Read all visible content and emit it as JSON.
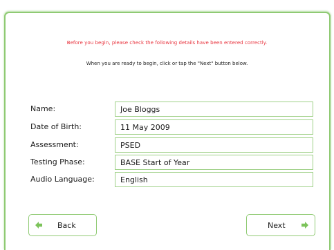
{
  "colors": {
    "accent_green": "#8fca73",
    "warning_red": "#e8323c"
  },
  "notice": {
    "warning": "Before you begin, please check the following details have been entered correctly.",
    "instruction": "When you are ready to begin, click or tap the \"Next\" button below."
  },
  "details": {
    "name": {
      "label": "Name:",
      "value": "Joe Bloggs"
    },
    "dob": {
      "label": "Date of Birth:",
      "value": "11 May 2009"
    },
    "assessment": {
      "label": "Assessment:",
      "value": "PSED"
    },
    "phase": {
      "label": "Testing Phase:",
      "value": "BASE Start of Year"
    },
    "language": {
      "label": "Audio Language:",
      "value": "English"
    }
  },
  "nav": {
    "back_label": "Back",
    "back_icon": "arrow-left-icon",
    "next_label": "Next",
    "next_icon": "arrow-right-icon"
  }
}
